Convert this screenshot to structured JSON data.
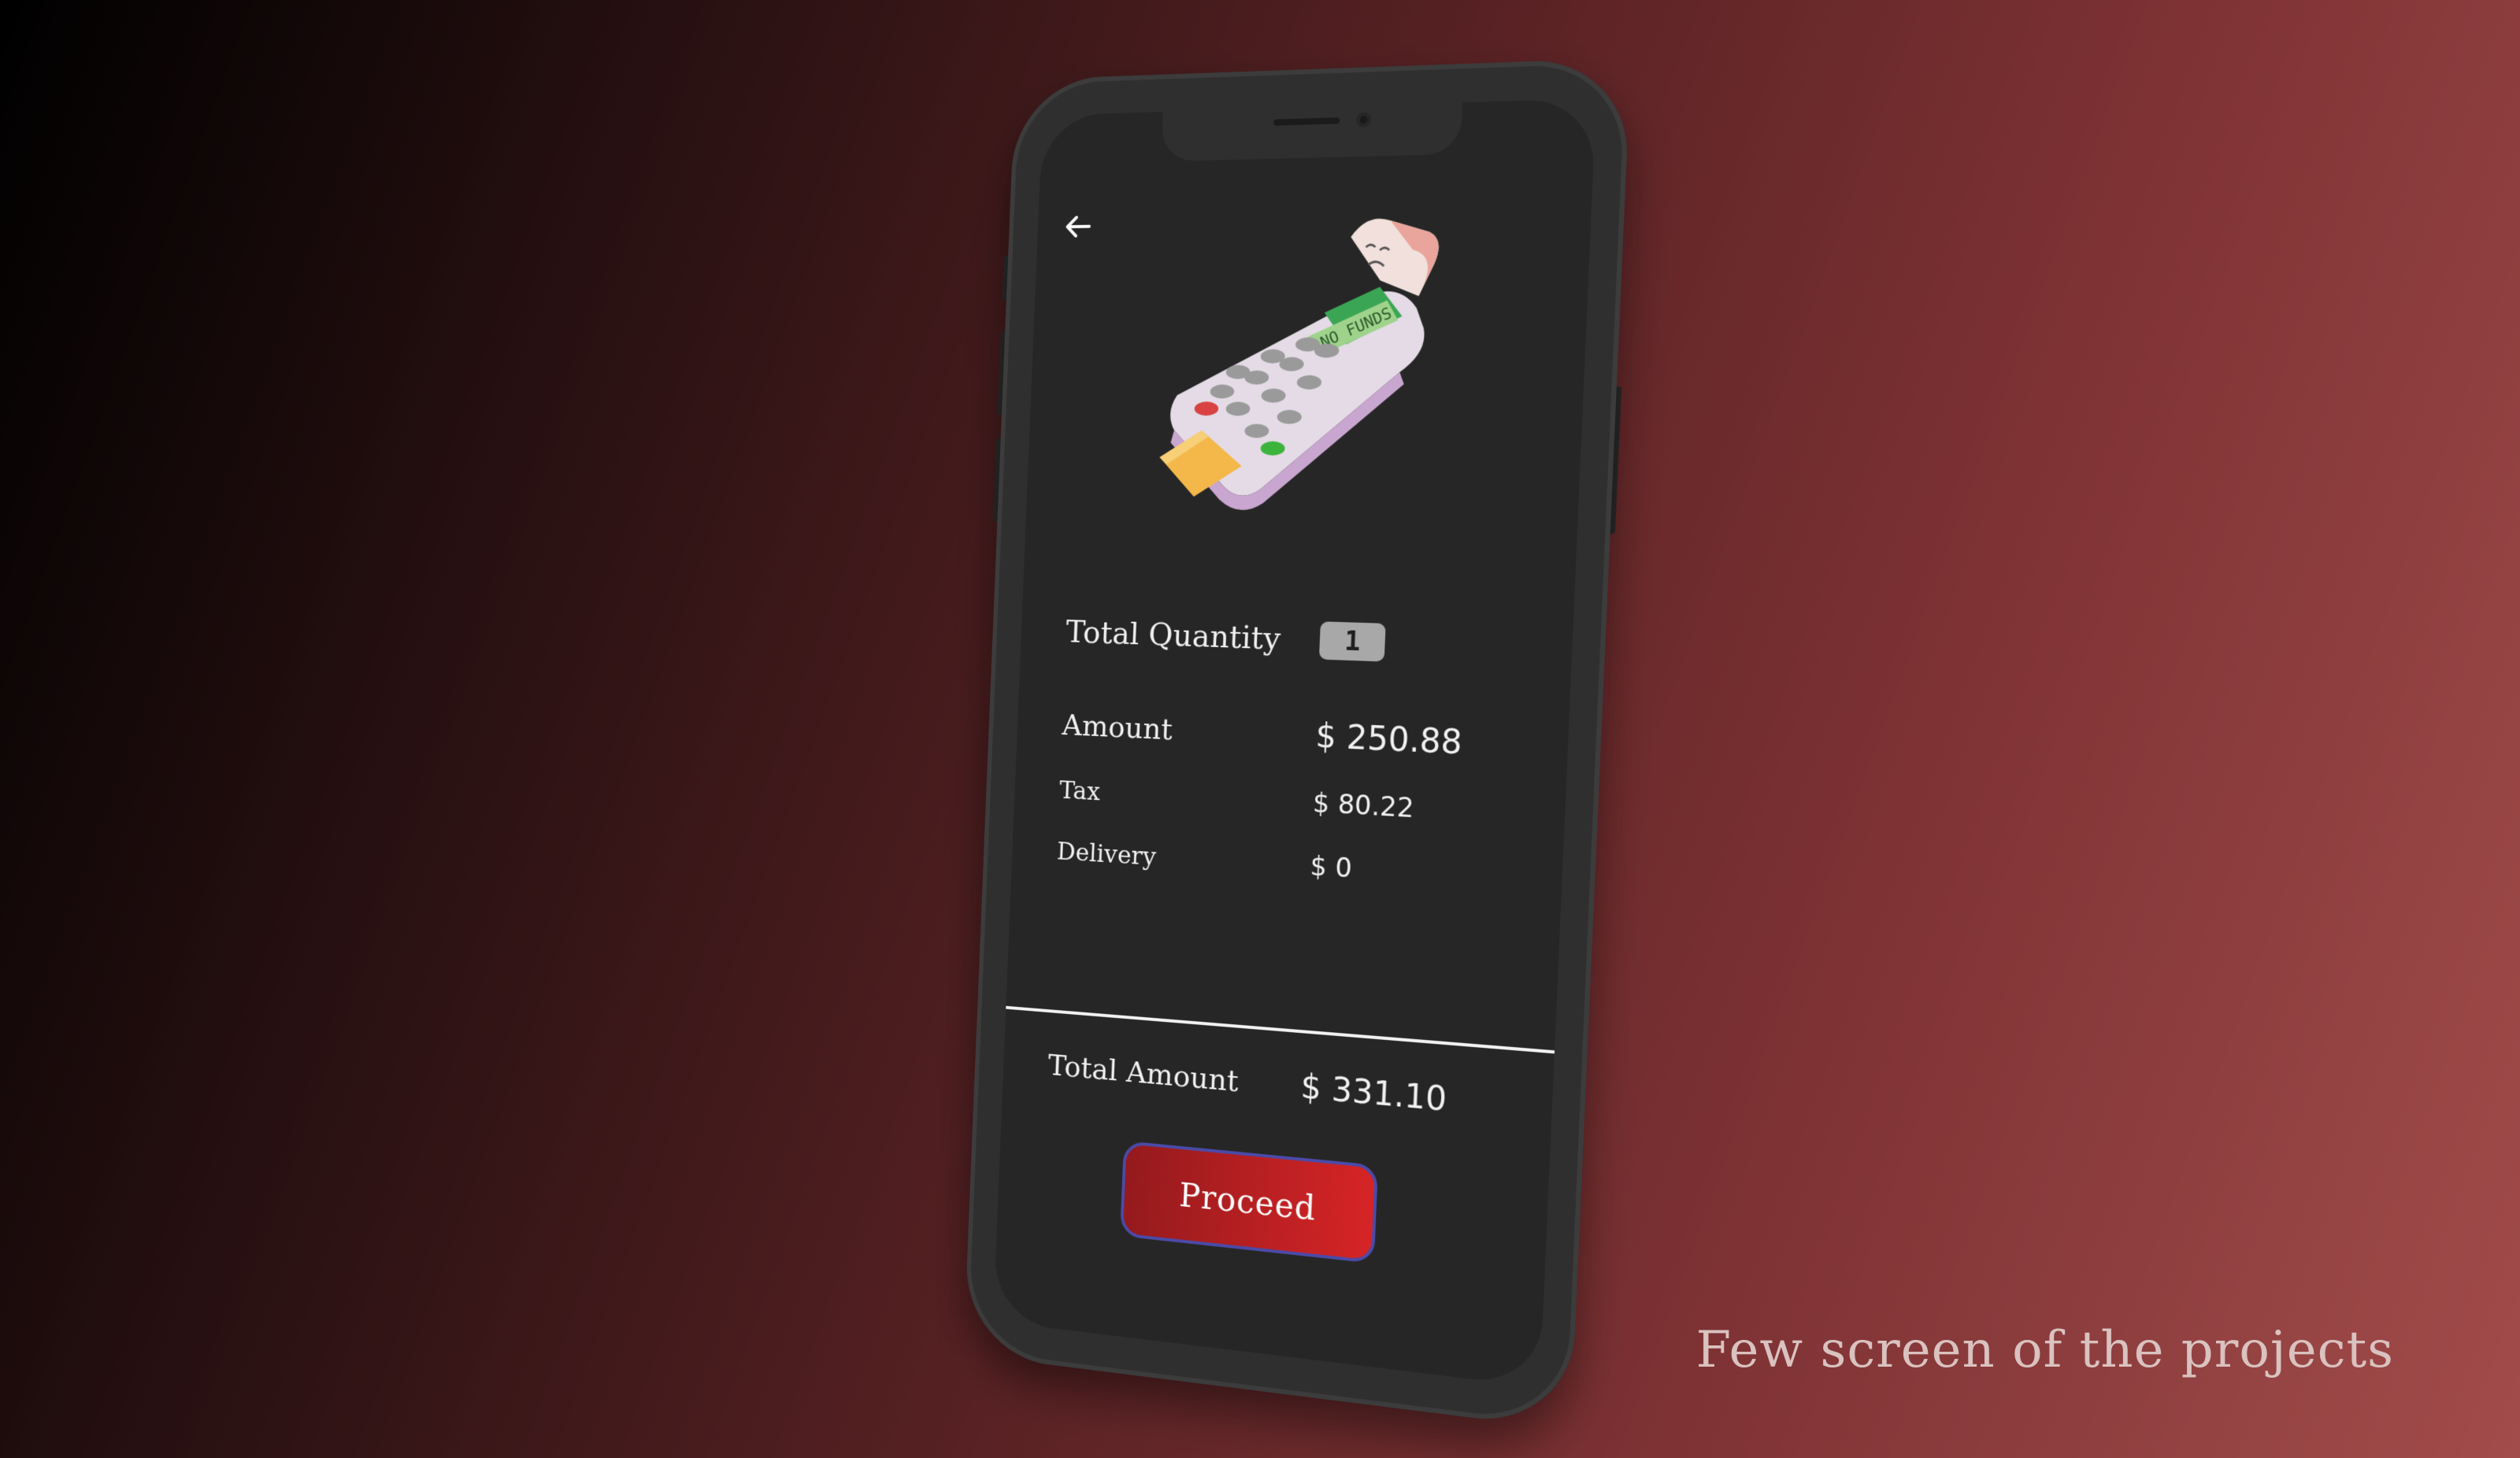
{
  "caption": "Few screen of the projects",
  "screen": {
    "back_icon": "arrow-left-icon",
    "illustration": {
      "icon": "payment-terminal-icon",
      "terminal_display_text": "NO FUNDS"
    },
    "rows": {
      "quantity": {
        "label": "Total Quantity",
        "value": "1"
      },
      "amount": {
        "label": "Amount",
        "value": "$ 250.88"
      },
      "tax": {
        "label": "Tax",
        "value": "$ 80.22"
      },
      "delivery": {
        "label": "Delivery",
        "value": "$ 0"
      }
    },
    "total": {
      "label": "Total Amount",
      "value": "$ 331.10"
    },
    "proceed_label": "Proceed"
  },
  "colors": {
    "screen_bg": "#262626",
    "button_gradient_start": "#941a1d",
    "button_gradient_end": "#d62426",
    "button_border": "#4b4aa8",
    "text": "#f1f1f1"
  }
}
